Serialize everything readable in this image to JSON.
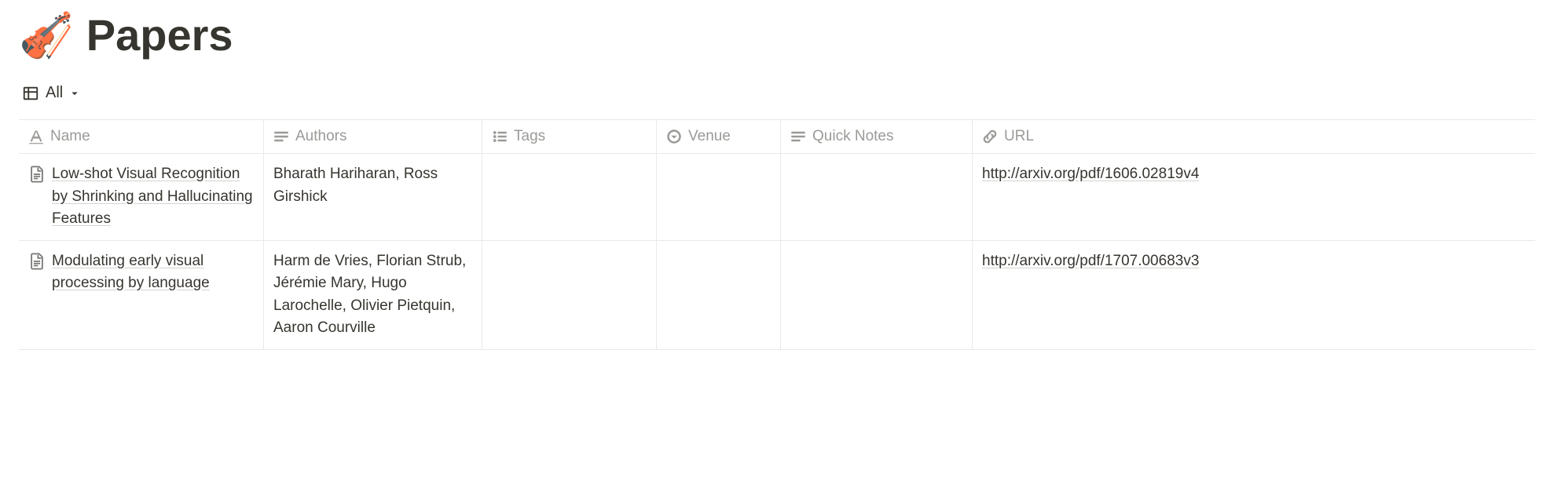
{
  "header": {
    "icon": "🎻",
    "title": "Papers"
  },
  "view": {
    "label": "All"
  },
  "columns": {
    "name": "Name",
    "authors": "Authors",
    "tags": "Tags",
    "venue": "Venue",
    "quick_notes": "Quick Notes",
    "url": "URL"
  },
  "rows": [
    {
      "name": "Low-shot Visual Recognition by Shrinking and Hallucinating Features",
      "authors": "Bharath Hariharan, Ross Girshick",
      "tags": "",
      "venue": "",
      "quick_notes": "",
      "url": "http://arxiv.org/pdf/1606.02819v4"
    },
    {
      "name": "Modulating early visual processing by language",
      "authors": "Harm de Vries, Florian Strub, Jérémie Mary, Hugo Larochelle, Olivier Pietquin, Aaron Courville",
      "tags": "",
      "venue": "",
      "quick_notes": "",
      "url": "http://arxiv.org/pdf/1707.00683v3"
    }
  ]
}
